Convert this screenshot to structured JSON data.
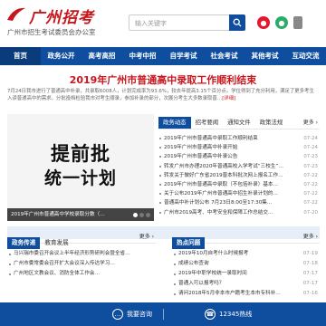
{
  "header": {
    "logo_text": "广州招考",
    "subtitle": "广州市招生考试委员会办公室",
    "search_placeholder": "输入关键字",
    "social": [
      "weibo-icon",
      "wechat-icon",
      "mobile-icon"
    ]
  },
  "nav": {
    "items": [
      "首页",
      "政务公开",
      "高考高招",
      "中考中招",
      "自学考试",
      "社会考试",
      "其他考试",
      "互动交流"
    ],
    "active_index": 0
  },
  "headline": {
    "title": "2019年广州市普通高中录取工作顺利结束",
    "summary": "7月24日我市进行了普通高中补录，共录取6008人，计划完成率为93.6%，较去年提高3.15个百分点。学位得到了充分利用，满足了更多考生入读普通高中的需求。分批投档检验我市对考生顺录，参加补录的部分，次展分考生大多数录取普…",
    "more": "[详细]"
  },
  "slide": {
    "line1": "提前批",
    "line2": "统一计划",
    "caption": "2019年广州市普通高中学校录取分数（…",
    "dots": 3,
    "active_dot": 0
  },
  "news": {
    "tabs": [
      "政务动态",
      "招考要闻",
      "通知文件",
      "政策法规"
    ],
    "active_tab": 0,
    "more": "更多 ›",
    "items": [
      {
        "title": "2019年广州市普通高中录取工作顺利结束",
        "date": "07-24"
      },
      {
        "title": "2019年广州市普通高中补录开始",
        "date": "07-24"
      },
      {
        "title": "2019年广州市普通高中补录公告",
        "date": "07-23"
      },
      {
        "title": "转发广州市办理2020年普通高校入学考试“三校生”…",
        "date": "07-23"
      },
      {
        "title": "转发关于做好广东省2019普本科批次网上报名工作…",
        "date": "07-22"
      },
      {
        "title": "2019年广州市普通高中录取（不包括补录）基本…",
        "date": "07-22"
      },
      {
        "title": "关于公布2019年广州市普通高中招生补录计划的…",
        "date": "07-22"
      },
      {
        "title": "普通高中补计划公布 7月23日8:00至17:30集…",
        "date": "07-22"
      },
      {
        "title": "广州市2019高考、中考安全和保障工作总结交…",
        "date": "07-20"
      }
    ]
  },
  "policy_section": {
    "tab_active": "政务传递",
    "tab_other": "教育发展",
    "more": "更多 ›",
    "items": [
      "马兴瑞市委召开会议上半年经济形势研判会暨全省…",
      "广州市委常委会召开扩大会议深入传达学习…",
      "广州地区文教会议、消防全体工作会…"
    ]
  },
  "hot_section": {
    "title": "热点问题",
    "more": "更多 ›",
    "items": [
      {
        "title": "2019年10月自考什么时候报考",
        "date": "07-19"
      },
      {
        "title": "成绩公布查询",
        "date": "07-18"
      },
      {
        "title": "2019年中职学校统一录取时间",
        "date": "07-17"
      },
      {
        "title": "普通入可以报考吗？",
        "date": "07-17"
      },
      {
        "title": "请问2018年5月非本市户籍考生本市专科补…",
        "date": "07-16"
      }
    ]
  },
  "bottom_bar": {
    "consult": "我要咨询",
    "hotline": "12345热线"
  },
  "colors": {
    "brand_blue": "#0f4e9e",
    "brand_red": "#c8161d"
  }
}
